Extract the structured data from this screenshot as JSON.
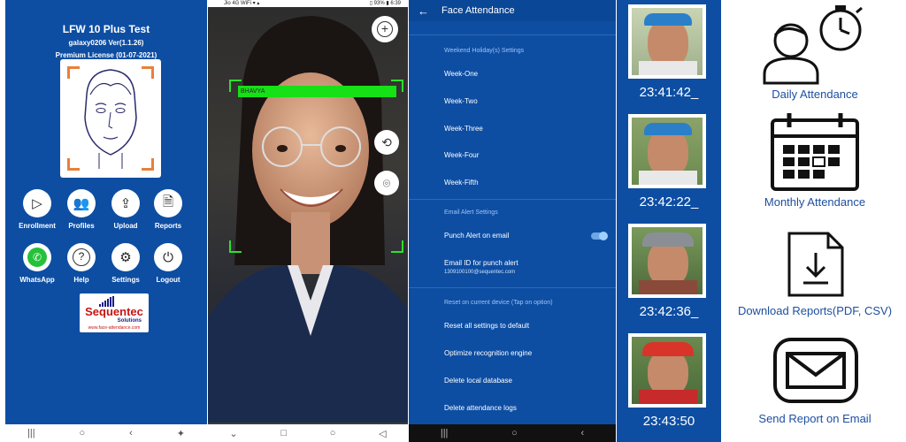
{
  "panel1": {
    "title": "LFW 10 Plus Test",
    "version": "galaxy0206 Ver(1.1.26)",
    "license": "Premium License (01-07-2021)",
    "buttons": [
      {
        "label": "Enrollment",
        "icon": "play-icon"
      },
      {
        "label": "Profiles",
        "icon": "profiles-icon"
      },
      {
        "label": "Upload",
        "icon": "upload-icon"
      },
      {
        "label": "Reports",
        "icon": "reports-icon"
      },
      {
        "label": "WhatsApp",
        "icon": "whatsapp-icon"
      },
      {
        "label": "Help",
        "icon": "help-icon"
      },
      {
        "label": "Settings",
        "icon": "gear-icon"
      },
      {
        "label": "Logout",
        "icon": "power-icon"
      }
    ],
    "logo": {
      "name": "Sequentec",
      "tagline": "Solutions",
      "url": "www.face-attendance.com"
    },
    "nav": [
      "|||",
      "○",
      "‹",
      "✦"
    ]
  },
  "panel2": {
    "status_text": "Jio 4G WiFi ▾ ▴",
    "status_right": "▯ 93% ▮ 6:39",
    "detected_name": "BHAVYA",
    "nav": [
      "⌄",
      "□",
      "○",
      "◁"
    ]
  },
  "panel3": {
    "title": "Face Attendance",
    "weekend_header": "Weekend Holiday(s) Settings",
    "weeks": [
      "Week-One",
      "Week-Two",
      "Week-Three",
      "Week-Four",
      "Week-Fifth"
    ],
    "email_header": "Email Alert Settings",
    "punch_alert": "Punch Alert on email",
    "punch_alert_on": true,
    "email_id_label": "Email ID for punch alert",
    "email_id_value": "1309100100@sequentec.com",
    "reset_header": "Reset on current device (Tap on option)",
    "reset_items": [
      "Reset all settings to default",
      "Optimize recognition engine",
      "Delete local database",
      "Delete attendance logs"
    ],
    "nav": [
      "|||",
      "○",
      "‹"
    ]
  },
  "panel4": {
    "entries": [
      {
        "time": "23:41:42_"
      },
      {
        "time": "23:42:22_"
      },
      {
        "time": "23:42:36_"
      },
      {
        "time": "23:43:50"
      }
    ]
  },
  "panel5": {
    "features": [
      {
        "label": "Daily Attendance",
        "icon": "person-clock-icon"
      },
      {
        "label": "Monthly Attendance",
        "icon": "calendar-icon"
      },
      {
        "label": "Download Reports(PDF, CSV)",
        "icon": "download-file-icon"
      },
      {
        "label": "Send Report on Email",
        "icon": "email-icon"
      }
    ]
  },
  "colors": {
    "brand_blue": "#0d4ea3",
    "accent_orange": "#e8803a",
    "detect_green": "#16e016",
    "label_blue": "#1d4fa0"
  }
}
